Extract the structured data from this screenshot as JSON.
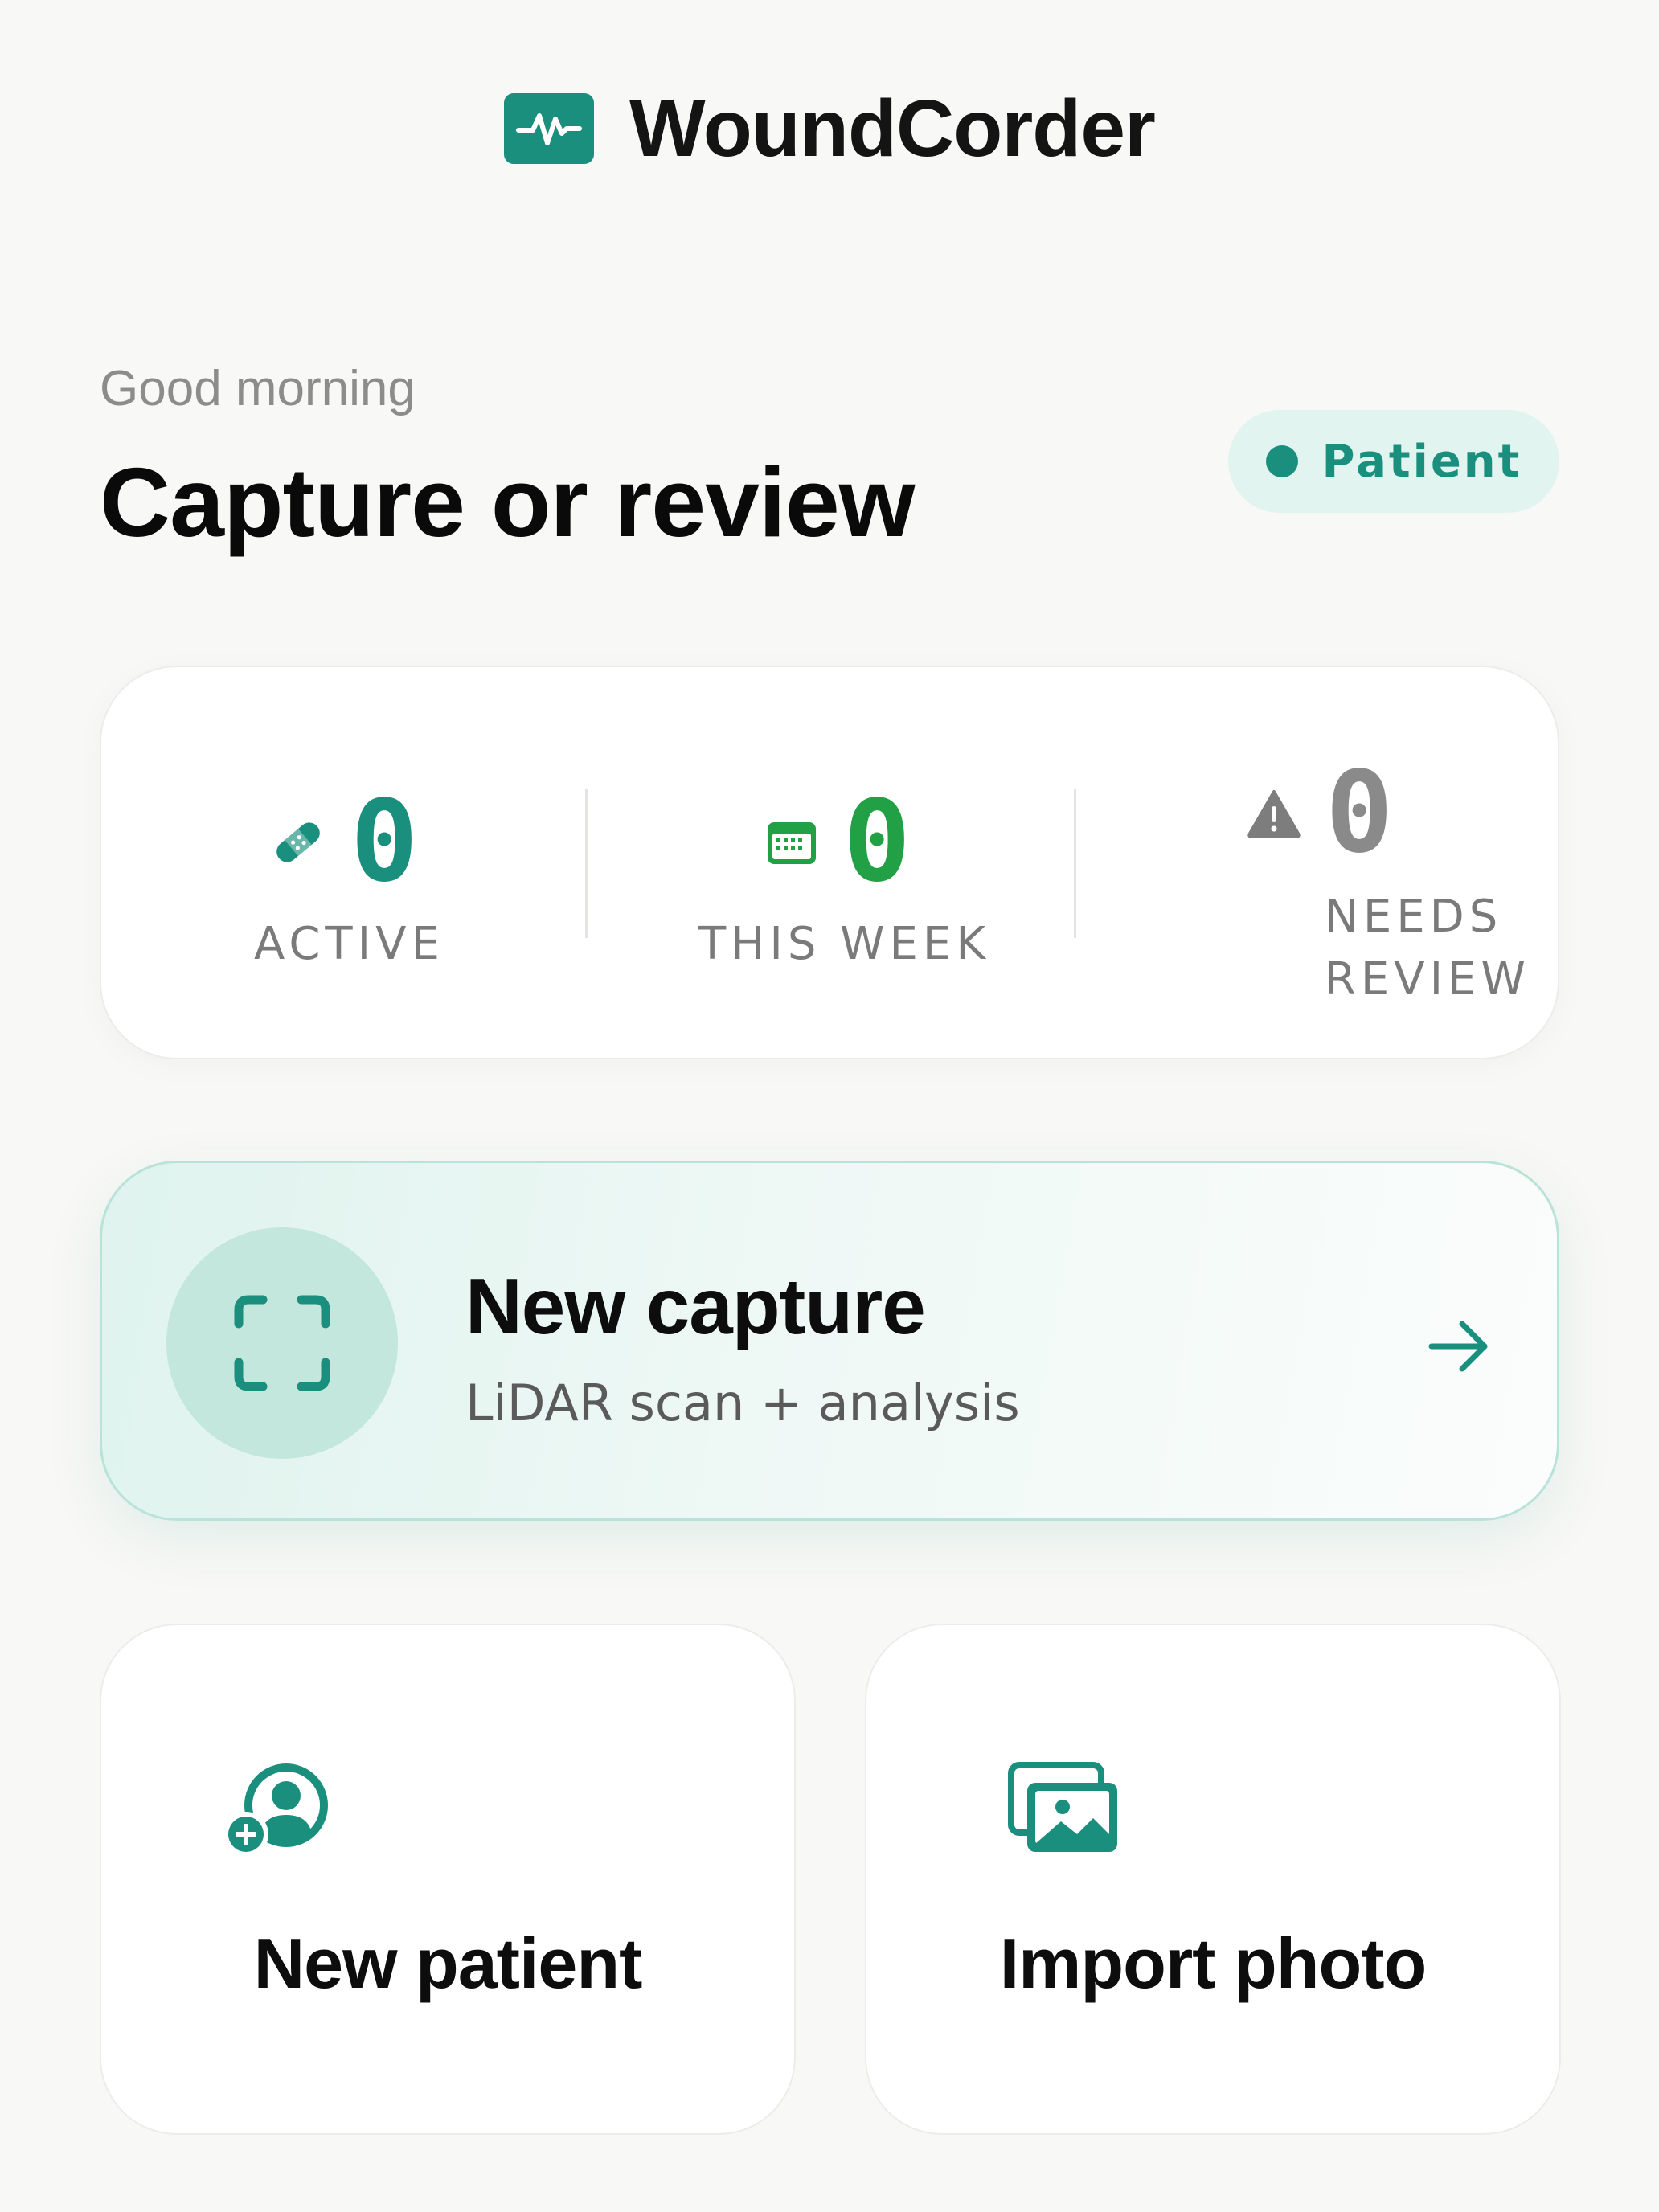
{
  "header": {
    "app_title": "WoundCorder",
    "logo_icon": "pulse-icon"
  },
  "greeting": {
    "subtitle": "Good morning",
    "title": "Capture or review"
  },
  "role_badge": {
    "label": "Patient"
  },
  "stats": [
    {
      "icon": "bandage-icon",
      "value": "0",
      "label": "ACTIVE",
      "color": "#1a8f7e"
    },
    {
      "icon": "calendar-icon",
      "value": "0",
      "label": "THIS WEEK",
      "color": "#22a046"
    },
    {
      "icon": "warning-icon",
      "value": "0",
      "label_line1": "NEEDS",
      "label_line2": "REVIEW",
      "color": "#8a8a8a"
    }
  ],
  "capture": {
    "title": "New capture",
    "subtitle": "LiDAR scan + analysis",
    "icon": "scan-frame-icon",
    "arrow": "arrow-right-icon"
  },
  "actions": [
    {
      "label": "New patient",
      "icon": "add-user-icon"
    },
    {
      "label": "Import photo",
      "icon": "photos-icon"
    }
  ],
  "colors": {
    "accent": "#1a8f7e",
    "green": "#22a046",
    "badge_bg": "#e2f4ef",
    "background": "#f8f8f6"
  }
}
